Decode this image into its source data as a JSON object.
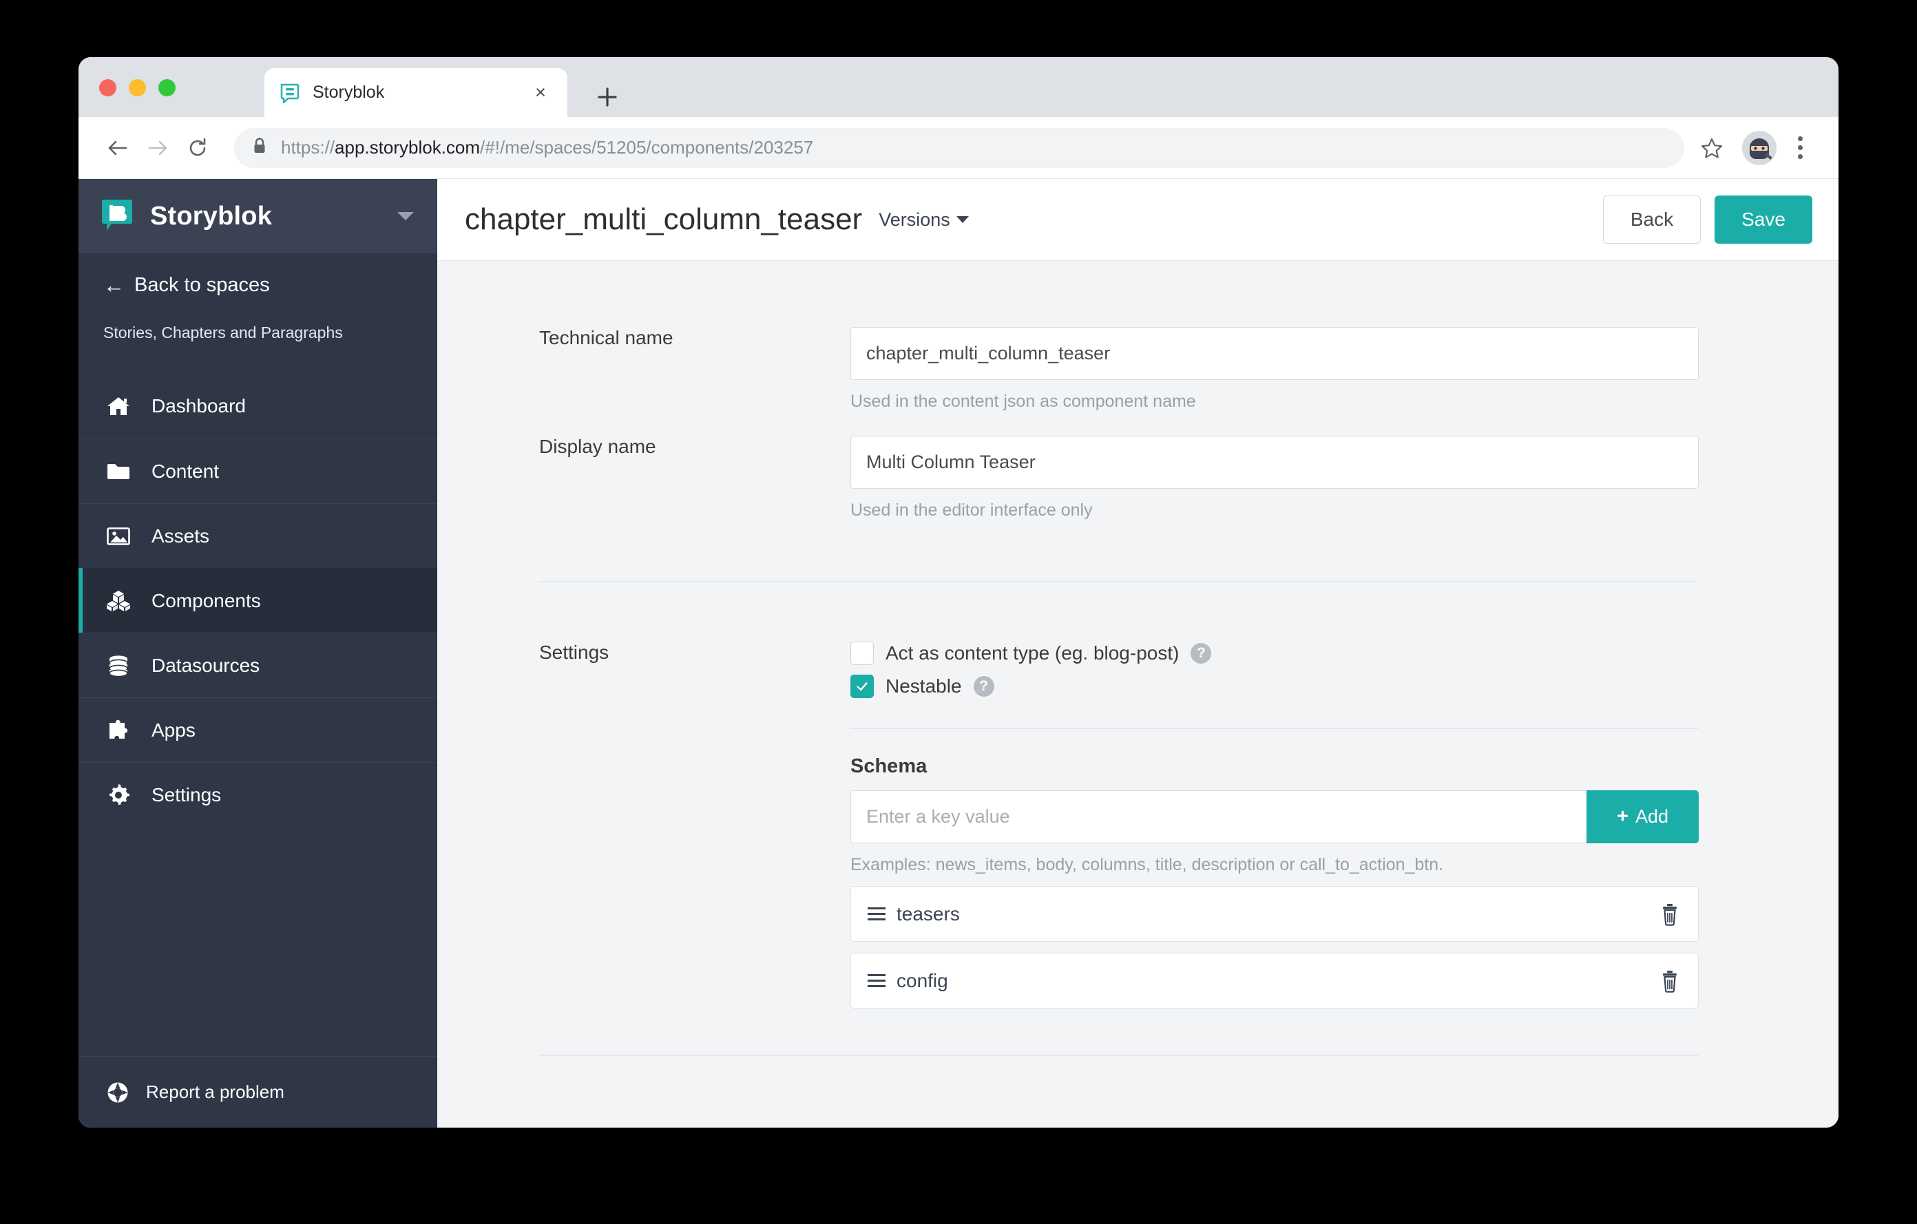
{
  "browser": {
    "tab": {
      "title": "Storyblok",
      "favicon": "storyblok-favicon",
      "close_label": "×"
    },
    "new_tab_label": "+",
    "nav": {
      "back": "←",
      "forward": "→",
      "reload": "⟳"
    },
    "url": {
      "scheme": "https://",
      "host": "app.storyblok.com",
      "path": "/#!/me/spaces/51205/components/203257",
      "full": "https://app.storyblok.com/#!/me/spaces/51205/components/203257",
      "lock_icon": "lock-icon"
    },
    "bookmark_icon": "star-icon",
    "profile_icon": "ninja-avatar-icon",
    "menu_icon": "kebab-menu-icon"
  },
  "sidebar": {
    "brand": {
      "name": "Storyblok",
      "logo_icon": "storyblok-logo-icon",
      "caret_icon": "chevron-down-icon"
    },
    "back_to_spaces": {
      "label": "Back to spaces",
      "arrow": "←"
    },
    "space_name": "Stories, Chapters and Paragraphs",
    "items": [
      {
        "label": "Dashboard",
        "icon": "home-icon",
        "active": false
      },
      {
        "label": "Content",
        "icon": "folder-icon",
        "active": false
      },
      {
        "label": "Assets",
        "icon": "image-icon",
        "active": false
      },
      {
        "label": "Components",
        "icon": "cubes-icon",
        "active": true
      },
      {
        "label": "Datasources",
        "icon": "database-icon",
        "active": false
      },
      {
        "label": "Apps",
        "icon": "puzzle-icon",
        "active": false
      },
      {
        "label": "Settings",
        "icon": "gear-icon",
        "active": false
      }
    ],
    "report_problem": {
      "label": "Report a problem",
      "icon": "lifebuoy-icon"
    }
  },
  "header": {
    "title": "chapter_multi_column_teaser",
    "versions_label": "Versions",
    "back_label": "Back",
    "save_label": "Save"
  },
  "form": {
    "technical_name": {
      "label": "Technical name",
      "value": "chapter_multi_column_teaser",
      "hint": "Used in the content json as component name"
    },
    "display_name": {
      "label": "Display name",
      "value": "Multi Column Teaser",
      "hint": "Used in the editor interface only"
    },
    "settings": {
      "label": "Settings",
      "checkboxes": [
        {
          "label": "Act as content type (eg. blog-post)",
          "checked": false,
          "help": "?"
        },
        {
          "label": "Nestable",
          "checked": true,
          "help": "?"
        }
      ]
    },
    "schema": {
      "title": "Schema",
      "key_placeholder": "Enter a key value",
      "key_value": "",
      "add_label": "Add",
      "examples": "Examples: news_items, body, columns, title, description or call_to_action_btn.",
      "rows": [
        {
          "name": "teasers",
          "delete_icon": "trash-icon",
          "handle_icon": "drag-handle-icon"
        },
        {
          "name": "config",
          "delete_icon": "trash-icon",
          "handle_icon": "drag-handle-icon"
        }
      ]
    }
  },
  "colors": {
    "accent": "#1bada8",
    "sidebar": "#2f3747",
    "sidebar_active": "#262d3b",
    "page_bg": "#f2f4f6"
  }
}
